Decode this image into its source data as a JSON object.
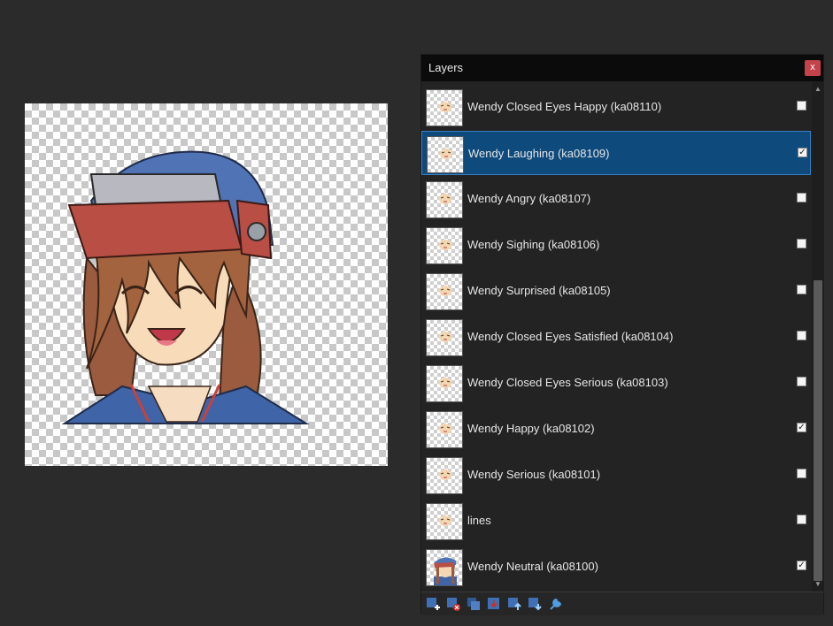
{
  "panel": {
    "title": "Layers",
    "close_label": "x"
  },
  "layers": [
    {
      "name": "Wendy Closed Eyes Happy (ka08110)",
      "visible": false,
      "selected": false
    },
    {
      "name": "Wendy Laughing (ka08109)",
      "visible": true,
      "selected": true
    },
    {
      "name": "Wendy Angry (ka08107)",
      "visible": false,
      "selected": false
    },
    {
      "name": "Wendy Sighing (ka08106)",
      "visible": false,
      "selected": false
    },
    {
      "name": "Wendy Surprised (ka08105)",
      "visible": false,
      "selected": false
    },
    {
      "name": "Wendy Closed Eyes Satisfied (ka08104)",
      "visible": false,
      "selected": false
    },
    {
      "name": "Wendy Closed Eyes Serious (ka08103)",
      "visible": false,
      "selected": false
    },
    {
      "name": "Wendy Happy (ka08102)",
      "visible": true,
      "selected": false
    },
    {
      "name": "Wendy Serious (ka08101)",
      "visible": false,
      "selected": false
    },
    {
      "name": "lines",
      "visible": false,
      "selected": false
    },
    {
      "name": "Wendy Neutral (ka08100)",
      "visible": true,
      "selected": false
    }
  ],
  "check_mark": "✓",
  "scroll": {
    "up_arrow": "▲",
    "down_arrow": "▼"
  },
  "toolbar": [
    {
      "icon": "add-layer-icon"
    },
    {
      "icon": "delete-layer-icon"
    },
    {
      "icon": "duplicate-layer-icon"
    },
    {
      "icon": "merge-layer-down-icon"
    },
    {
      "icon": "move-layer-up-icon"
    },
    {
      "icon": "move-layer-down-icon"
    },
    {
      "icon": "layer-properties-icon"
    }
  ],
  "colors": {
    "background": "#2b2b2b",
    "panel": "#232323",
    "header": "#0b0b0b",
    "selection": "#0f4a7c",
    "close": "#c4424a"
  }
}
